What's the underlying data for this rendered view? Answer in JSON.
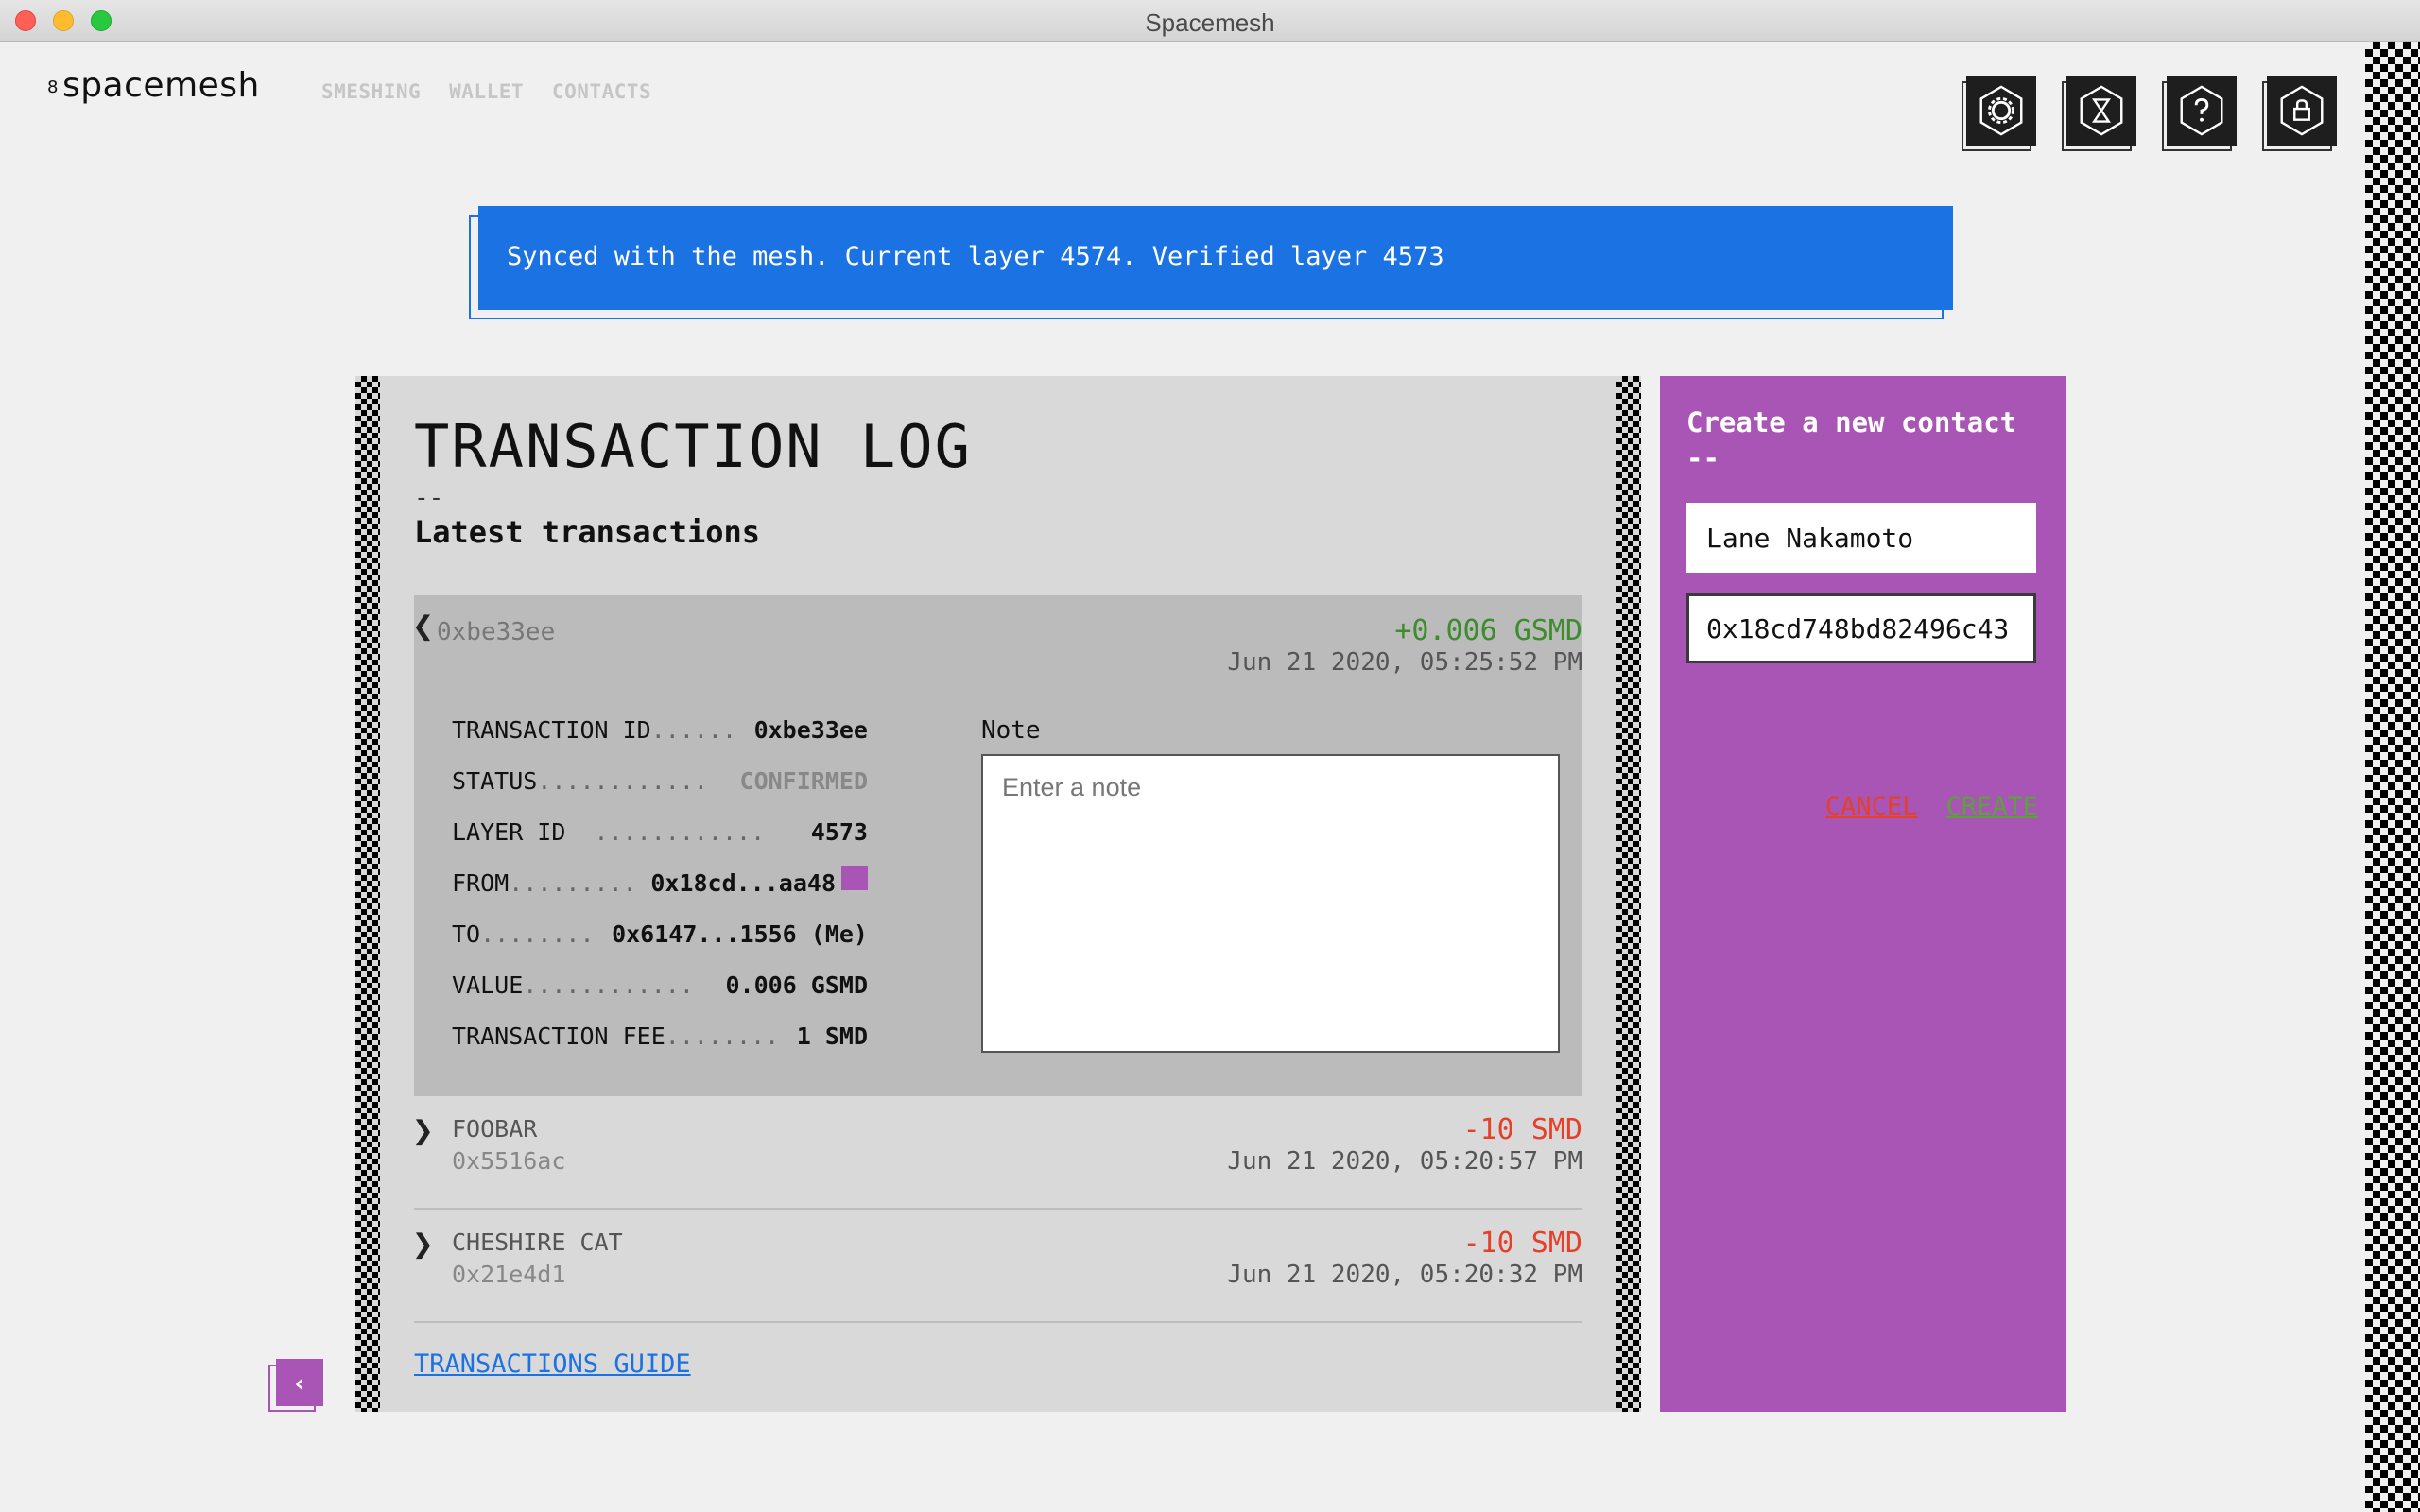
{
  "window": {
    "title": "Spacemesh"
  },
  "header": {
    "logo": "spacemesh",
    "logo_mark": "8",
    "nav": [
      "SMESHING",
      "WALLET",
      "CONTACTS"
    ],
    "icons": [
      "settings-icon",
      "hourglass-icon",
      "help-icon",
      "lock-icon"
    ]
  },
  "banner": {
    "text": "Synced with the mesh. Current layer 4574. Verified layer 4573"
  },
  "log": {
    "title": "TRANSACTION LOG",
    "dash": "--",
    "subtitle": "Latest transactions",
    "expanded": {
      "address": "0xbe33ee",
      "amount": "+0.006 GSMD",
      "date": "Jun 21 2020, 05:25:52 PM",
      "details": [
        {
          "label": "TRANSACTION ID",
          "dots": "......",
          "value": "0xbe33ee"
        },
        {
          "label": "STATUS ",
          "dots": "............",
          "value": "CONFIRMED"
        },
        {
          "label": "LAYER ID  ",
          "dots": "............",
          "value": "4573"
        },
        {
          "label": "FROM",
          "dots": ".........",
          "value": "0x18cd...aa48"
        },
        {
          "label": "TO",
          "dots": "........",
          "value": "0x6147...1556 (Me)"
        },
        {
          "label": "VALUE ",
          "dots": "............",
          "value": "0.006 GSMD"
        },
        {
          "label": "TRANSACTION FEE",
          "dots": "........",
          "value": "1 SMD"
        }
      ],
      "note_label": "Note",
      "note_placeholder": "Enter a note"
    },
    "rows": [
      {
        "name": "FOOBAR",
        "address": "0x5516ac",
        "amount": "-10 SMD",
        "date": "Jun 21 2020, 05:20:57 PM"
      },
      {
        "name": "CHESHIRE CAT",
        "address": "0x21e4d1",
        "amount": "-10 SMD",
        "date": "Jun 21 2020, 05:20:32 PM"
      }
    ],
    "guide_link": "TRANSACTIONS GUIDE"
  },
  "contact": {
    "title": "Create a new contact",
    "dash": "--",
    "name_value": "Lane Nakamoto",
    "address_value": "0x18cd748bd82496c43",
    "cancel": "CANCEL",
    "create": "CREATE"
  },
  "colors": {
    "brand_purple": "#a855b5",
    "banner_blue": "#1b72e3",
    "positive": "#3d8c2d",
    "negative": "#e4402b"
  }
}
